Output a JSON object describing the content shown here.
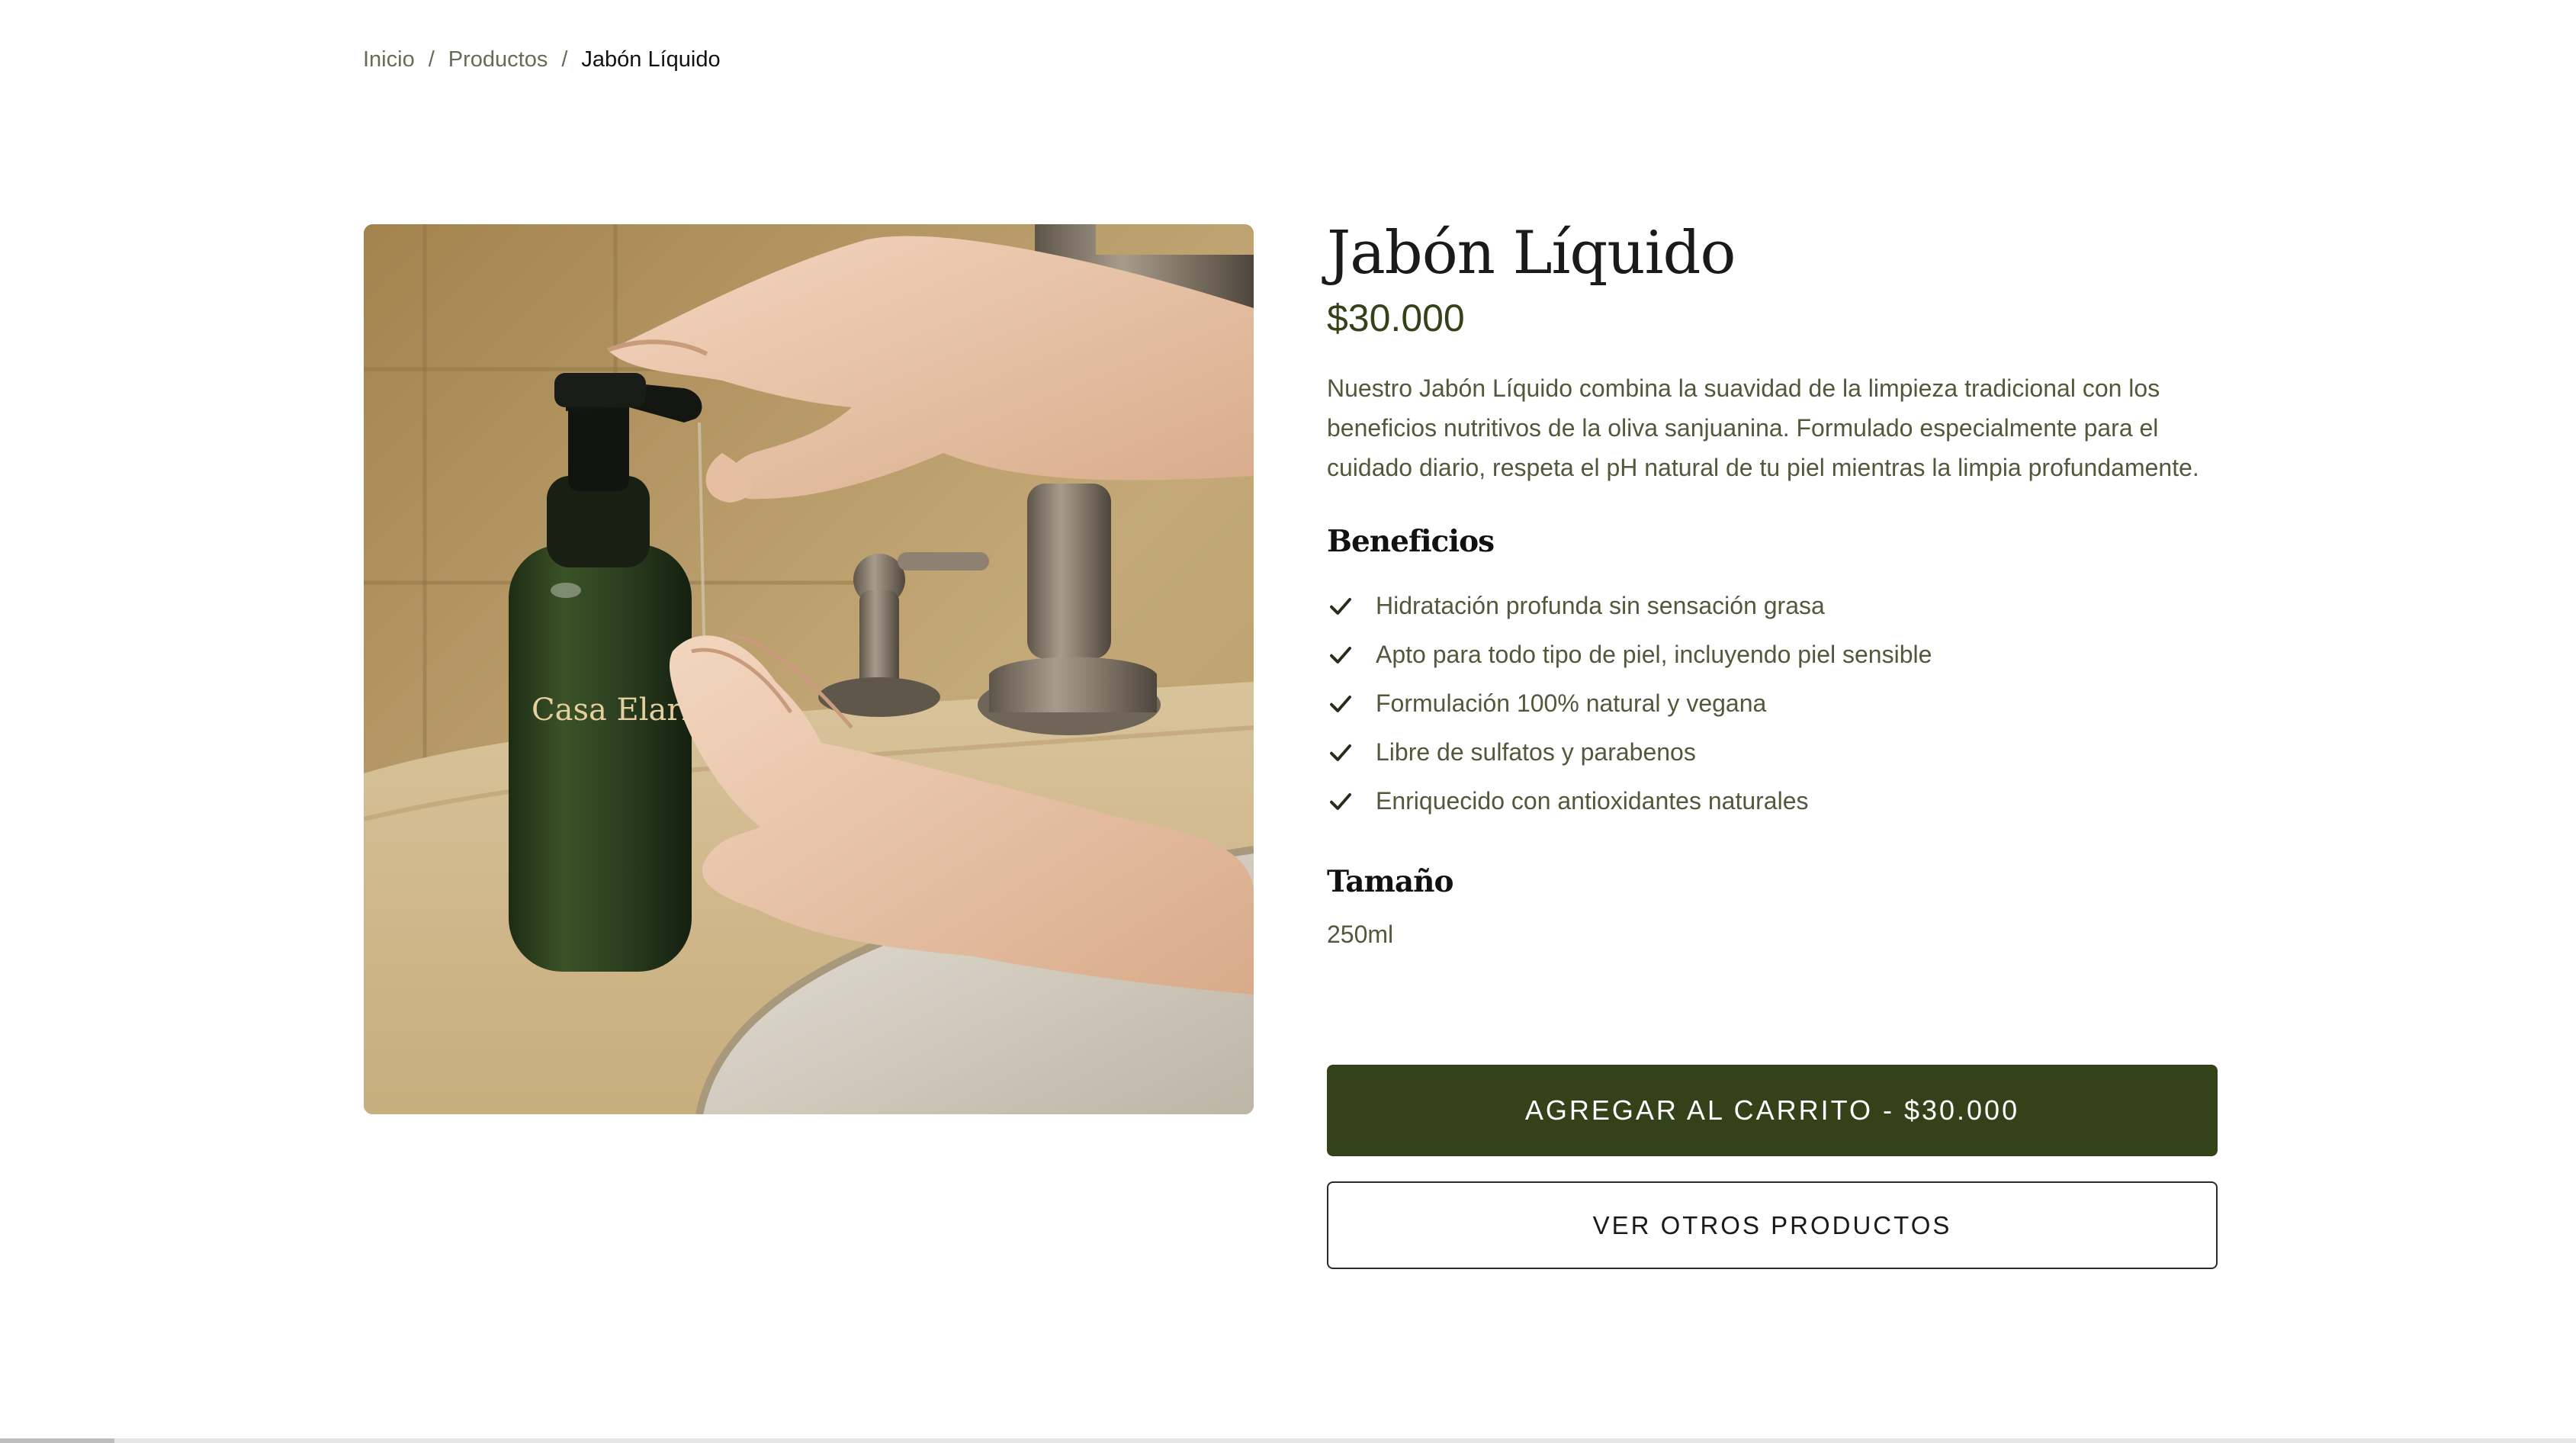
{
  "breadcrumb": {
    "home": "Inicio",
    "separator": "/",
    "category": "Productos",
    "current": "Jabón Líquido"
  },
  "product": {
    "image_alt": "Manos usando un dispensador de Jabón Líquido junto a un lavabo",
    "bottle_label": "Casa Elaria",
    "title": "Jabón Líquido",
    "price": "$30.000",
    "description": "Nuestro Jabón Líquido combina la suavidad de la limpieza tradicional con los beneficios nutritivos de la oliva sanjuanina. Formulado especialmente para el cuidado diario, respeta el pH natural de tu piel mientras la limpia profundamente.",
    "benefits_heading": "Beneficios",
    "benefits": [
      "Hidratación profunda sin sensación grasa",
      "Apto para todo tipo de piel, incluyendo piel sensible",
      "Formulación 100% natural y vegana",
      "Libre de sulfatos y parabenos",
      "Enriquecido con antioxidantes naturales"
    ],
    "size_heading": "Tamaño",
    "size_value": "250ml"
  },
  "actions": {
    "add_to_cart": "AGREGAR AL CARRITO - $30.000",
    "see_other_products": "VER OTROS PRODUCTOS"
  },
  "colors": {
    "accent_green": "#344219",
    "body_text": "#55573c",
    "heading": "#111111"
  },
  "icons": {
    "benefit_icon": "check-icon"
  }
}
